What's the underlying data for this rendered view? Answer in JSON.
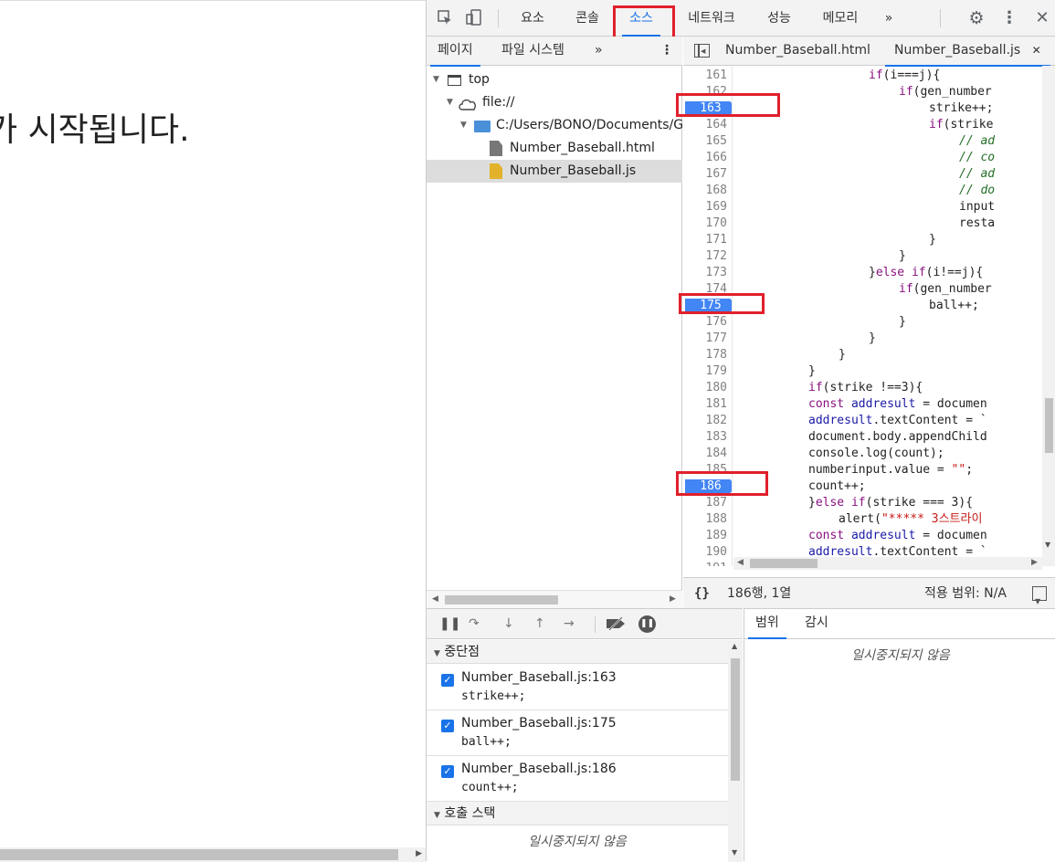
{
  "page": {
    "text": "가 시작됩니다."
  },
  "toolbar": {
    "tabs": [
      "요소",
      "콘솔",
      "소스",
      "네트워크",
      "성능",
      "메모리"
    ],
    "more": "»"
  },
  "navigator": {
    "tabs": [
      "페이지",
      "파일 시스템"
    ],
    "more": "»",
    "tree": [
      "top",
      "file://",
      "C:/Users/BONO/Documents/GitHub",
      "Number_Baseball.html",
      "Number_Baseball.js"
    ]
  },
  "editor": {
    "tabs": [
      "Number_Baseball.html",
      "Number_Baseball.js"
    ],
    "lines": [
      {
        "n": "161",
        "bp": false
      },
      {
        "n": "162",
        "bp": false
      },
      {
        "n": "163",
        "bp": true
      },
      {
        "n": "164",
        "bp": false
      },
      {
        "n": "165",
        "bp": false
      },
      {
        "n": "166",
        "bp": false
      },
      {
        "n": "167",
        "bp": false
      },
      {
        "n": "168",
        "bp": false
      },
      {
        "n": "169",
        "bp": false
      },
      {
        "n": "170",
        "bp": false
      },
      {
        "n": "171",
        "bp": false
      },
      {
        "n": "172",
        "bp": false
      },
      {
        "n": "173",
        "bp": false
      },
      {
        "n": "174",
        "bp": false
      },
      {
        "n": "175",
        "bp": true
      },
      {
        "n": "176",
        "bp": false
      },
      {
        "n": "177",
        "bp": false
      },
      {
        "n": "178",
        "bp": false
      },
      {
        "n": "179",
        "bp": false
      },
      {
        "n": "180",
        "bp": false
      },
      {
        "n": "181",
        "bp": false
      },
      {
        "n": "182",
        "bp": false
      },
      {
        "n": "183",
        "bp": false
      },
      {
        "n": "184",
        "bp": false
      },
      {
        "n": "185",
        "bp": false
      },
      {
        "n": "186",
        "bp": true
      },
      {
        "n": "187",
        "bp": false
      },
      {
        "n": "188",
        "bp": false
      },
      {
        "n": "189",
        "bp": false
      },
      {
        "n": "190",
        "bp": false
      },
      {
        "n": "191",
        "bp": false
      }
    ],
    "code": [
      {
        "indent": 6,
        "parts": [
          [
            "kw",
            "if"
          ],
          [
            "",
            "(i"
          ],
          [
            "",
            "==="
          ],
          [
            "",
            "j){"
          ]
        ]
      },
      {
        "indent": 7,
        "parts": [
          [
            "kw",
            "if"
          ],
          [
            "",
            "(gen_number"
          ]
        ]
      },
      {
        "indent": 8,
        "parts": [
          [
            "",
            "strike++;"
          ]
        ]
      },
      {
        "indent": 8,
        "parts": [
          [
            "kw",
            "if"
          ],
          [
            "",
            "(strike"
          ]
        ]
      },
      {
        "indent": 9,
        "parts": [
          [
            "cm",
            "// ad"
          ]
        ]
      },
      {
        "indent": 9,
        "parts": [
          [
            "cm",
            "// co"
          ]
        ]
      },
      {
        "indent": 9,
        "parts": [
          [
            "cm",
            "// ad"
          ]
        ]
      },
      {
        "indent": 9,
        "parts": [
          [
            "cm",
            "// do"
          ]
        ]
      },
      {
        "indent": 9,
        "parts": [
          [
            "",
            "input"
          ]
        ]
      },
      {
        "indent": 9,
        "parts": [
          [
            "",
            "resta"
          ]
        ]
      },
      {
        "indent": 8,
        "parts": [
          [
            "",
            "}"
          ]
        ]
      },
      {
        "indent": 7,
        "parts": [
          [
            "",
            "}"
          ]
        ]
      },
      {
        "indent": 6,
        "parts": [
          [
            "",
            "}"
          ],
          [
            "kw",
            "else if"
          ],
          [
            "",
            "(i!==j){"
          ]
        ]
      },
      {
        "indent": 7,
        "parts": [
          [
            "kw",
            "if"
          ],
          [
            "",
            "(gen_number"
          ]
        ]
      },
      {
        "indent": 8,
        "parts": [
          [
            "",
            "ball++;"
          ]
        ]
      },
      {
        "indent": 7,
        "parts": [
          [
            "",
            "}"
          ]
        ]
      },
      {
        "indent": 6,
        "parts": [
          [
            "",
            "}"
          ]
        ]
      },
      {
        "indent": 5,
        "parts": [
          [
            "",
            "}"
          ]
        ]
      },
      {
        "indent": 4,
        "parts": [
          [
            "",
            "}"
          ]
        ]
      },
      {
        "indent": 4,
        "parts": [
          [
            "kw",
            "if"
          ],
          [
            "",
            "(strike !==3){"
          ]
        ]
      },
      {
        "indent": 4,
        "parts": [
          [
            "kw",
            "const"
          ],
          [
            "pr",
            " addresult"
          ],
          [
            "",
            " = documen"
          ]
        ]
      },
      {
        "indent": 4,
        "parts": [
          [
            "pr",
            "addresult"
          ],
          [
            "",
            ".textContent = `"
          ]
        ]
      },
      {
        "indent": 4,
        "parts": [
          [
            "",
            "document.body.appendChild"
          ]
        ]
      },
      {
        "indent": 4,
        "parts": [
          [
            "",
            "console.log(count);"
          ]
        ]
      },
      {
        "indent": 4,
        "parts": [
          [
            "",
            "numberinput.value = "
          ],
          [
            "st",
            "\"\""
          ],
          [
            "",
            ";"
          ]
        ]
      },
      {
        "indent": 4,
        "parts": [
          [
            "",
            "count++;"
          ]
        ]
      },
      {
        "indent": 4,
        "parts": [
          [
            "",
            "}"
          ],
          [
            "kw",
            "else if"
          ],
          [
            "",
            "(strike === 3){"
          ]
        ]
      },
      {
        "indent": 5,
        "parts": [
          [
            "",
            "alert("
          ],
          [
            "st",
            "\"***** 3스트라이"
          ]
        ]
      },
      {
        "indent": 4,
        "parts": [
          [
            "kw",
            "const"
          ],
          [
            "pr",
            " addresult"
          ],
          [
            "",
            " = documen"
          ]
        ]
      },
      {
        "indent": 4,
        "parts": [
          [
            "pr",
            "addresult"
          ],
          [
            "",
            ".textContent = `"
          ]
        ]
      },
      {
        "indent": 0,
        "parts": [
          [
            "",
            ""
          ]
        ]
      }
    ],
    "status": {
      "position": "186행, 1열",
      "coverage": "적용 범위: N/A"
    }
  },
  "debugger": {
    "breakpoints_title": "중단점",
    "breakpoints": [
      {
        "file": "Number_Baseball.js:163",
        "code": "strike++;"
      },
      {
        "file": "Number_Baseball.js:175",
        "code": "ball++;"
      },
      {
        "file": "Number_Baseball.js:186",
        "code": "count++;"
      }
    ],
    "callstack_title": "호출 스택",
    "not_paused": "일시중지되지 않음"
  },
  "scope": {
    "tabs": [
      "범위",
      "감시"
    ],
    "not_paused": "일시중지되지 않음"
  },
  "colors": {
    "accent": "#1a73e8",
    "breakpoint": "#4285f4",
    "highlight": "#e0202b"
  }
}
